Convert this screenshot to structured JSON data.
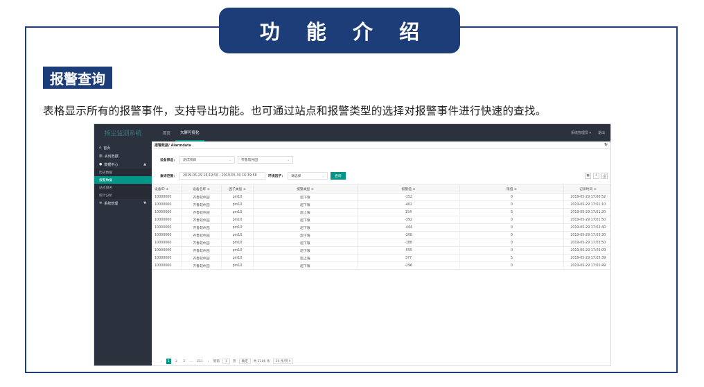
{
  "banner": {
    "title": "功 能 介 绍"
  },
  "section": {
    "tag": "报警查询",
    "description": "表格显示所有的报警事件，支持导出功能。也可通过站点和报警类型的选择对报警事件进行快速的查找。"
  },
  "app": {
    "brand": "扬尘监测系统",
    "top_nav": [
      {
        "label": "首页"
      },
      {
        "label": "大屏可视化"
      }
    ],
    "user_label": "系统管理员 ▾",
    "logout_label": "退出",
    "sidebar": {
      "home": "首页",
      "realtime": "实时数据",
      "data_center": "数据中心",
      "sub_items": [
        "历史数据",
        "报警数据",
        "站点排名",
        "统计分析"
      ],
      "system": "系统管理"
    },
    "breadcrumb": "报警数据/ Alarmdata",
    "filter": {
      "device_label": "设备筛选：",
      "device_value1": "测试项目",
      "device_value2": "齐鲁软件园",
      "range_label": "查询范围：",
      "range_value": "2019-05-29 16:19:56 - 2019-05-30 16:19:56",
      "factor_label": "环境因子：",
      "factor_value": "请选择",
      "query_button": "查询"
    },
    "table": {
      "headers": [
        "设备ID ≑",
        "设备名称 ≑",
        "因子类型 ≑",
        "报警类型 ≑",
        "报警值 ≑",
        "限值 ≑",
        "记录时间 ≑"
      ],
      "rows": [
        [
          "10000000",
          "齐鲁软件园",
          "pm10",
          "超下限",
          "-152",
          "0",
          "2019-05-29 17:00:52"
        ],
        [
          "10000000",
          "齐鲁软件园",
          "pm10",
          "超下限",
          "-402",
          "0",
          "2019-05-29 17:01:10"
        ],
        [
          "10000000",
          "齐鲁软件园",
          "pm10",
          "超上限",
          "154",
          "5",
          "2019-05-29 17:01:20"
        ],
        [
          "10000000",
          "齐鲁软件园",
          "pm10",
          "超下限",
          "-392",
          "0",
          "2019-05-29 17:01:50"
        ],
        [
          "10000000",
          "齐鲁软件园",
          "pm10",
          "超下限",
          "-444",
          "0",
          "2019-05-29 17:02:40"
        ],
        [
          "10000000",
          "齐鲁软件园",
          "pm10",
          "超下限",
          "-208",
          "0",
          "2019-05-29 17:03:30"
        ],
        [
          "10000000",
          "齐鲁软件园",
          "pm10",
          "超下限",
          "-188",
          "0",
          "2019-05-29 17:03:50"
        ],
        [
          "10000000",
          "齐鲁软件园",
          "pm10",
          "超下限",
          "-555",
          "0",
          "2019-05-29 17:05:09"
        ],
        [
          "10000000",
          "齐鲁软件园",
          "pm10",
          "超上限",
          "377",
          "5",
          "2019-05-29 17:05:39"
        ],
        [
          "10000000",
          "齐鲁软件园",
          "pm10",
          "超下限",
          "-296",
          "0",
          "2019-05-29 17:05:49"
        ]
      ]
    },
    "pagination": {
      "prev": "‹",
      "pages": [
        "1",
        "2",
        "3",
        "...",
        "211"
      ],
      "next": "›",
      "goto_label": "到第",
      "goto_value": "1",
      "page_unit": "页",
      "confirm": "确定",
      "total": "共 2106 条",
      "page_size": "10 条/页 ▾"
    }
  }
}
